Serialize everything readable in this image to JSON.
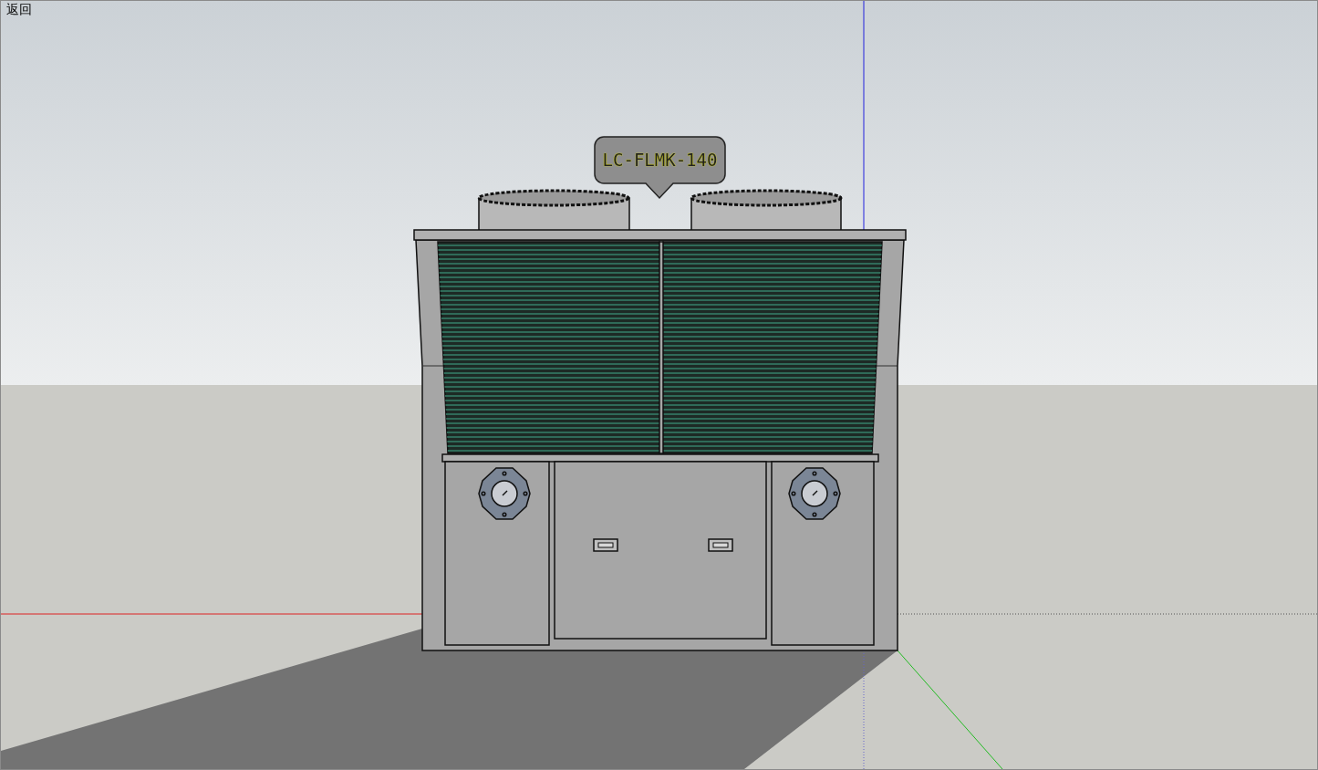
{
  "back_link": {
    "label": "返回"
  },
  "model_tag": {
    "text": "LC-FLMK-140"
  }
}
